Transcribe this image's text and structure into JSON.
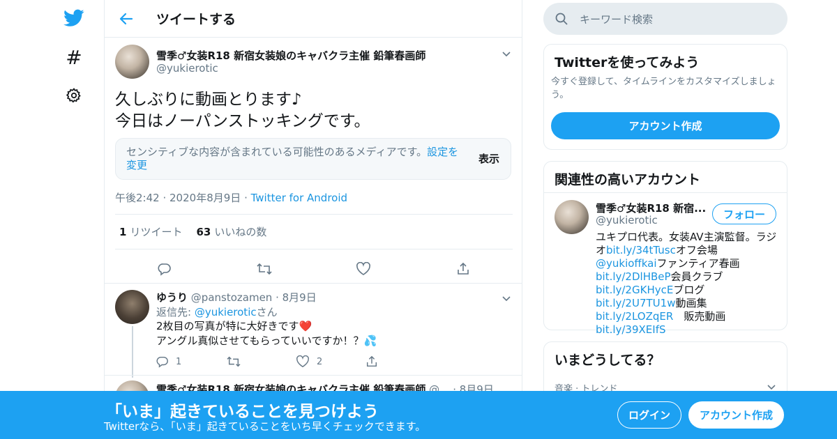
{
  "colors": {
    "accent": "#1da1f2",
    "link": "#1b95e0",
    "muted": "#657786",
    "like": "#e0245e"
  },
  "header": {
    "title": "ツイートする"
  },
  "tweet": {
    "name": "雪季♂女装R18 新宿女装娘のキャバクラ主催 鉛筆春画師",
    "handle": "@yukierotic",
    "line1": "久しぶりに動画とります♪",
    "line2": "今日はノーパンストッキングです。",
    "sensitive_text": "センシティブな内容が含まれている可能性のあるメディアです。",
    "sensitive_link": "設定を変更",
    "sensitive_show": "表示",
    "time": "午後2:42",
    "date": "2020年8月9日",
    "source": "Twitter for Android",
    "retweet_count": "1",
    "retweet_label": "リツイート",
    "like_count": "63",
    "like_label": "いいねの数"
  },
  "reply": {
    "name": "ゆうり",
    "handle": "@panstozamen",
    "date": "8月9日",
    "replying_prefix": "返信先: ",
    "replying_handle": "@yukierotic",
    "replying_suffix": "さん",
    "line1": "2枚目の写真が特に大好きです❤️",
    "line2": "アングル真似させてもらっていいですか！？💦",
    "reply_count": "1",
    "like_count": "2"
  },
  "reply2": {
    "name": "雪季♂女装R18 新宿女装娘のキャバクラ主催 鉛筆春画師",
    "handle": "@...",
    "date": "8月9日"
  },
  "search": {
    "placeholder": "キーワード検索"
  },
  "join_card": {
    "title": "Twitterを使ってみよう",
    "desc": "今すぐ登録して、タイムラインをカスタマイズしましょう。",
    "button": "アカウント作成"
  },
  "related": {
    "title": "関連性の高いアカウント",
    "name": "雪季♂女装R18 新宿...",
    "handle": "@yukierotic",
    "follow": "フォロー",
    "bio": [
      {
        "t": "ユキプロ代表。女装AV主演監督。ラジオ",
        "link": false
      },
      {
        "t": "bit.ly/34tTusc",
        "link": true
      },
      {
        "t": "オフ会場",
        "link": false
      },
      {
        "t": "@yukioffkai",
        "link": true
      },
      {
        "t": "ファンティア春画",
        "link": false
      },
      {
        "t": "bit.ly/2DlHBeP",
        "link": true
      },
      {
        "t": "会員クラブ",
        "link": false
      },
      {
        "t": "bit.ly/2GKHycE",
        "link": true
      },
      {
        "t": "ブログ",
        "link": false
      },
      {
        "t": "bit.ly/2U7TU1w",
        "link": true
      },
      {
        "t": "動画集",
        "link": false
      },
      {
        "t": "bit.ly/2LOZqER",
        "link": true
      },
      {
        "t": "　販売動画　",
        "link": false
      },
      {
        "t": "bit.ly/39XEIfS",
        "link": true
      }
    ]
  },
  "trends": {
    "title": "いまどうしてる？",
    "first": "音楽 · トレンド"
  },
  "banner": {
    "title": "「いま」起きていることを見つけよう",
    "subtitle": "Twitterなら、「いま」起きていることをいち早くチェックできます。",
    "login": "ログイン",
    "signup": "アカウント作成"
  }
}
